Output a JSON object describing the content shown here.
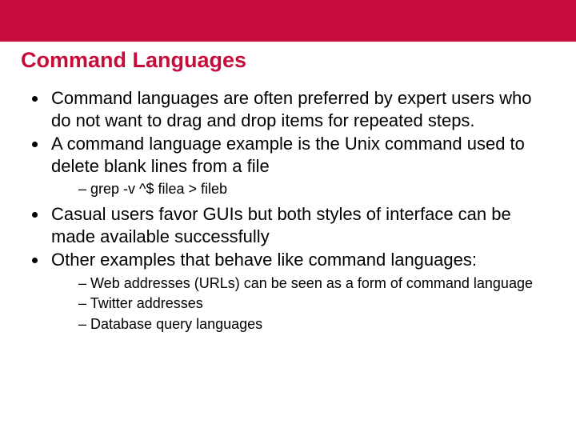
{
  "title": "Command Languages",
  "bullets": [
    "Command languages are often preferred by expert users who do not want to drag and drop items for repeated steps.",
    "A command language example is the Unix command used to delete blank lines from a file",
    "Casual users favor GUIs but both styles of interface can be made available successfully",
    "Other examples that behave like command languages:"
  ],
  "sub1": [
    "grep -v ^$ filea > fileb"
  ],
  "sub2": [
    "Web addresses (URLs) can be seen as a form of command language",
    "Twitter addresses",
    "Database query languages"
  ]
}
